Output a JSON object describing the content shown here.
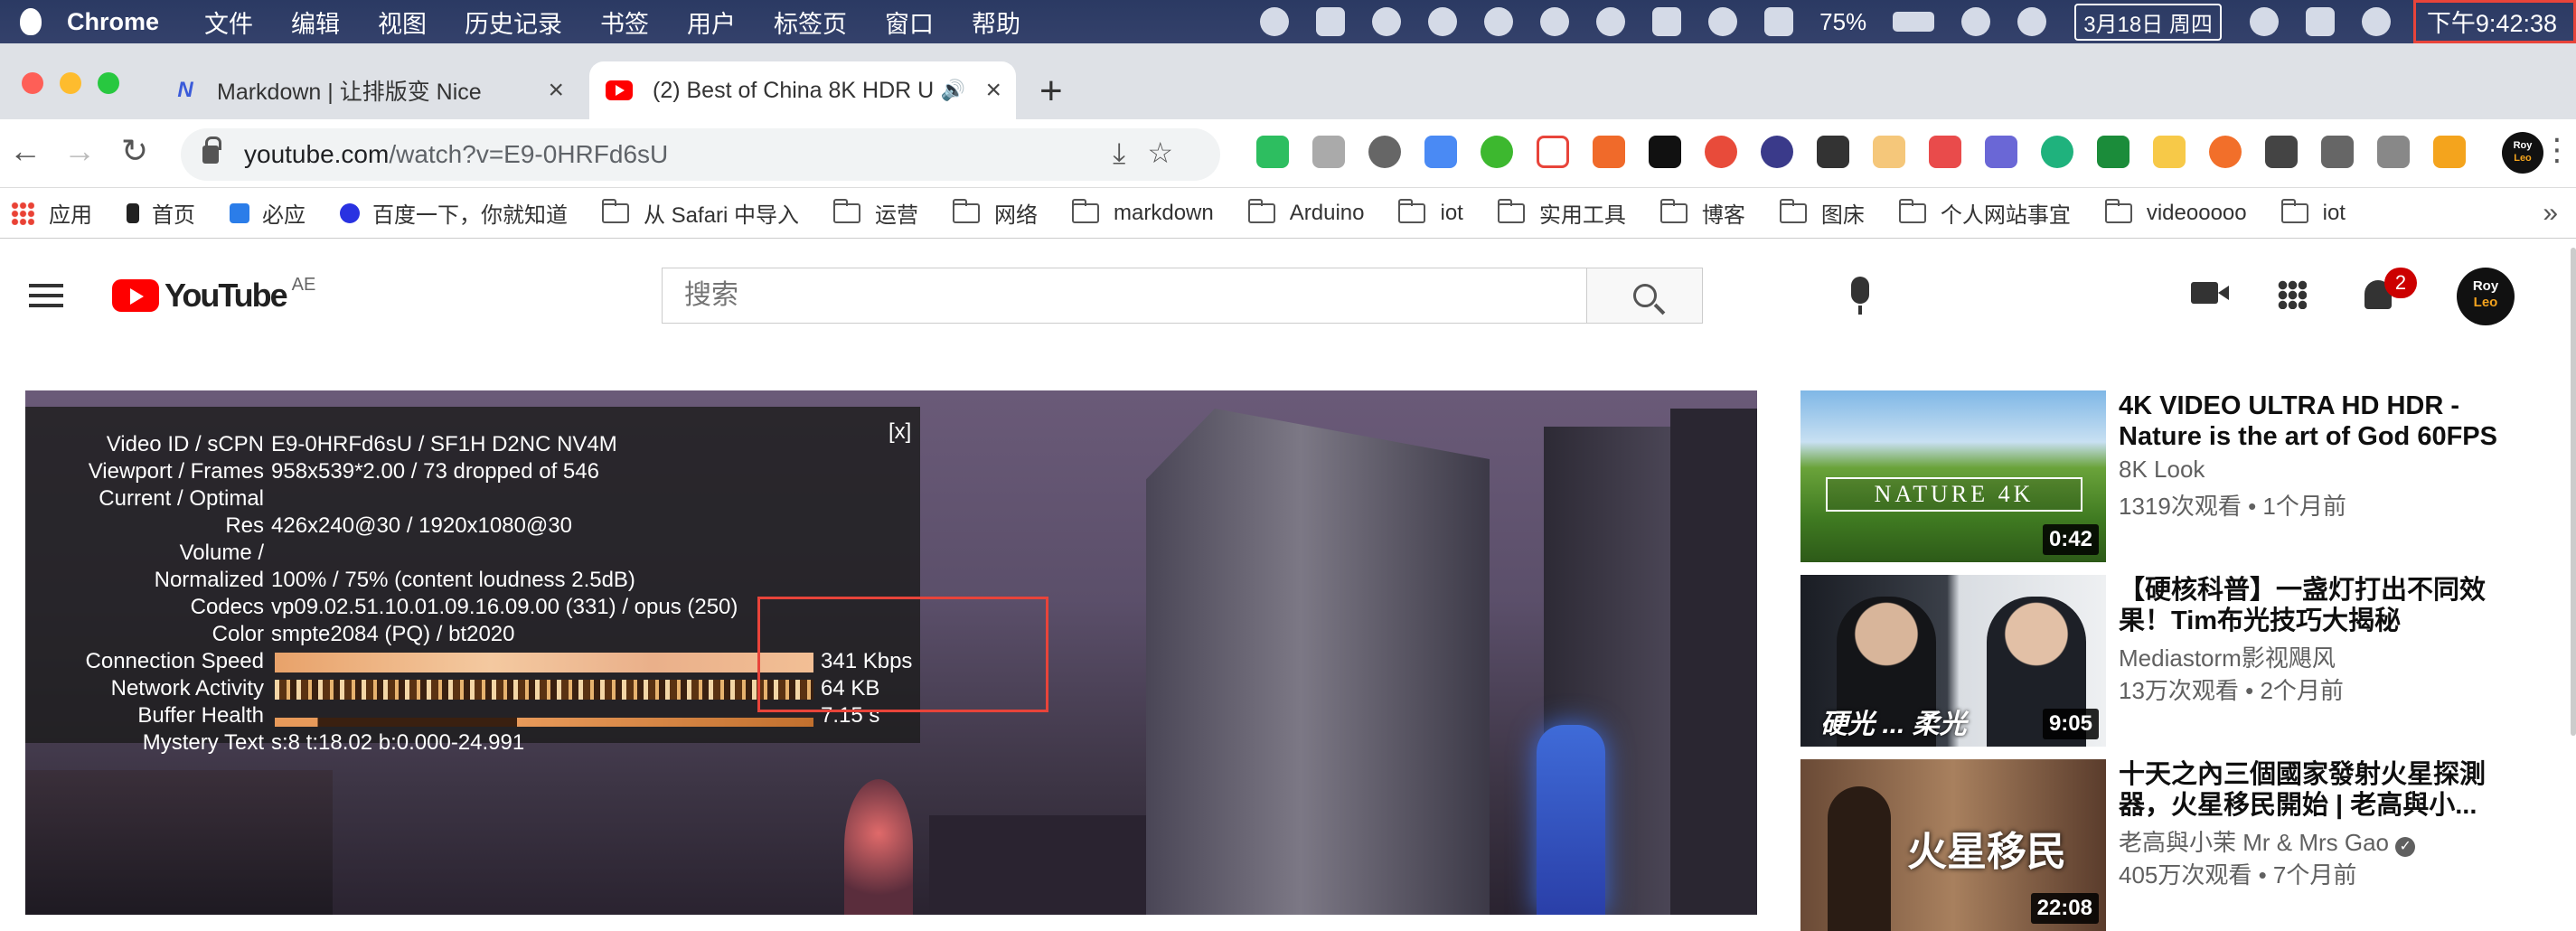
{
  "menubar": {
    "app": "Chrome",
    "items": [
      "文件",
      "编辑",
      "视图",
      "历史记录",
      "书签",
      "用户",
      "标签页",
      "窗口",
      "帮助"
    ],
    "battery": "75%",
    "date": "3月18日 周四",
    "clock": "下午9:42:38"
  },
  "tabs": [
    {
      "title": "Markdown | 让排版变 Nice",
      "favicon": "N"
    },
    {
      "title": "(2) Best of China 8K HDR U"
    }
  ],
  "address": {
    "host": "youtube.com",
    "path": "/watch?v=E9-0HRFd6sU"
  },
  "bookmarks": [
    "应用",
    "首页",
    "必应",
    "百度一下，你就知道",
    "从 Safari 中导入",
    "运营",
    "网络",
    "markdown",
    "Arduino",
    "iot",
    "实用工具",
    "博客",
    "图床",
    "个人网站事宜",
    "videooooo",
    "iot"
  ],
  "bookmarks_more": "»",
  "yt": {
    "logo": "YouTube",
    "region": "AE",
    "search_placeholder": "搜索",
    "notifications": "2",
    "avatar_top": "Roy",
    "avatar_bottom": "Leo",
    "colors": {
      "accent": "#ff0000",
      "badge": "#cc0000",
      "highlight": "#e8443a"
    }
  },
  "stats": {
    "close": "[x]",
    "rows": [
      {
        "label": "Video ID / sCPN",
        "value": "E9-0HRFd6sU / SF1H D2NC NV4M"
      },
      {
        "label": "Viewport / Frames",
        "value": "958x539*2.00 / 73 dropped of 546"
      },
      {
        "label": "Current / Optimal",
        "value": ""
      },
      {
        "label": "Res",
        "value": "426x240@30 / 1920x1080@30"
      },
      {
        "label": "Volume /",
        "value": ""
      },
      {
        "label": "Normalized",
        "value": "100% / 75% (content loudness 2.5dB)"
      },
      {
        "label": "Codecs",
        "value": "vp09.02.51.10.01.09.16.09.00 (331) / opus (250)"
      },
      {
        "label": "Color",
        "value": "smpte2084 (PQ) / bt2020"
      },
      {
        "label": "Connection Speed",
        "value": "341 Kbps"
      },
      {
        "label": "Network Activity",
        "value": "64 KB"
      },
      {
        "label": "Buffer Health",
        "value": "7.15 s"
      },
      {
        "label": "Mystery Text",
        "value": "s:8 t:18.02 b:0.000-24.991"
      }
    ]
  },
  "recommendations": [
    {
      "title": "4K VIDEO ULTRA HD HDR - Nature is the art of God 60FPS",
      "channel": "8K Look",
      "meta": "1319次观看 • 1个月前",
      "duration": "0:42",
      "thumb_text": "NATURE 4K"
    },
    {
      "title": "【硬核科普】一盏灯打出不同效果！Tim布光技巧大揭秘",
      "channel": "Mediastorm影视飓风",
      "meta": "13万次观看 • 2个月前",
      "duration": "9:05",
      "thumb_text": "硬光 ... 柔光"
    },
    {
      "title": "十天之內三個國家發射火星探測器，火星移民開始 | 老高與小...",
      "channel": "老高與小茉 Mr & Mrs Gao",
      "meta": "405万次观看 • 7个月前",
      "duration": "22:08",
      "thumb_text": "火星移民"
    }
  ]
}
